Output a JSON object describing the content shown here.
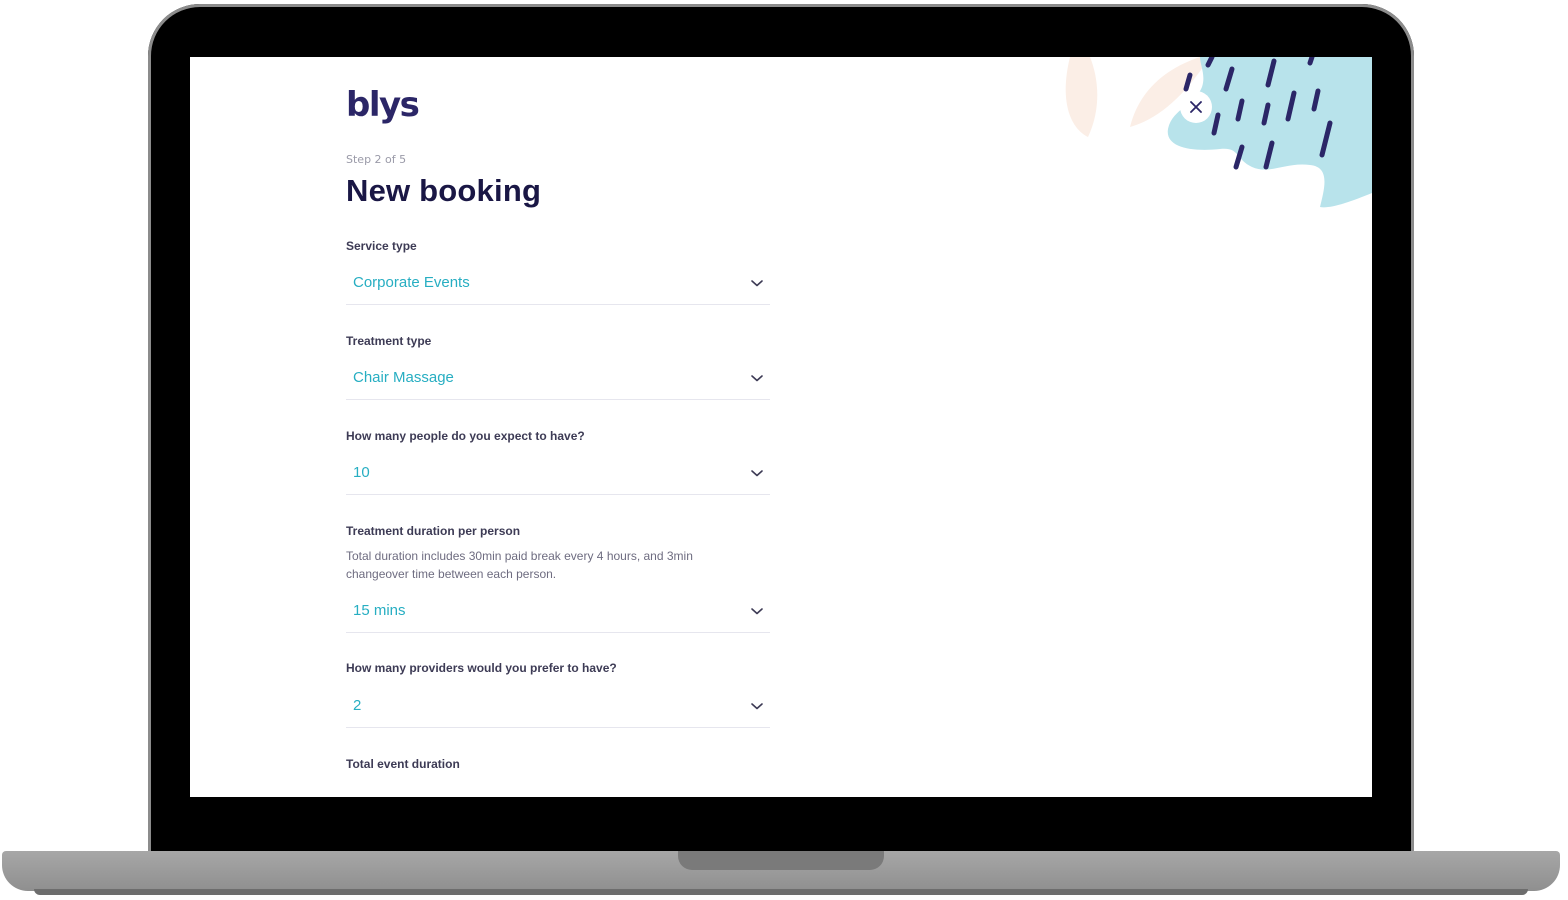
{
  "app": {
    "logo_text": "blys",
    "step_text": "Step 2 of 5",
    "page_title": "New booking"
  },
  "form": {
    "service_type": {
      "label": "Service type",
      "value": "Corporate Events"
    },
    "treatment_type": {
      "label": "Treatment type",
      "value": "Chair Massage"
    },
    "people_count": {
      "label": "How many people do you expect to have?",
      "value": "10"
    },
    "treatment_duration": {
      "label": "Treatment duration per person",
      "help": "Total duration includes 30min paid break every 4 hours, and 3min changeover time between each person.",
      "value": "15 mins"
    },
    "providers_count": {
      "label": "How many providers would you prefer to have?",
      "value": "2"
    },
    "total_duration": {
      "label": "Total event duration"
    }
  },
  "icons": {
    "close": "close-icon",
    "chevron": "chevron-down-icon"
  },
  "colors": {
    "brand_navy": "#2b2667",
    "accent_teal": "#27aec2",
    "deco_blue": "#b8e3eb",
    "deco_peach": "#fbeee6"
  }
}
